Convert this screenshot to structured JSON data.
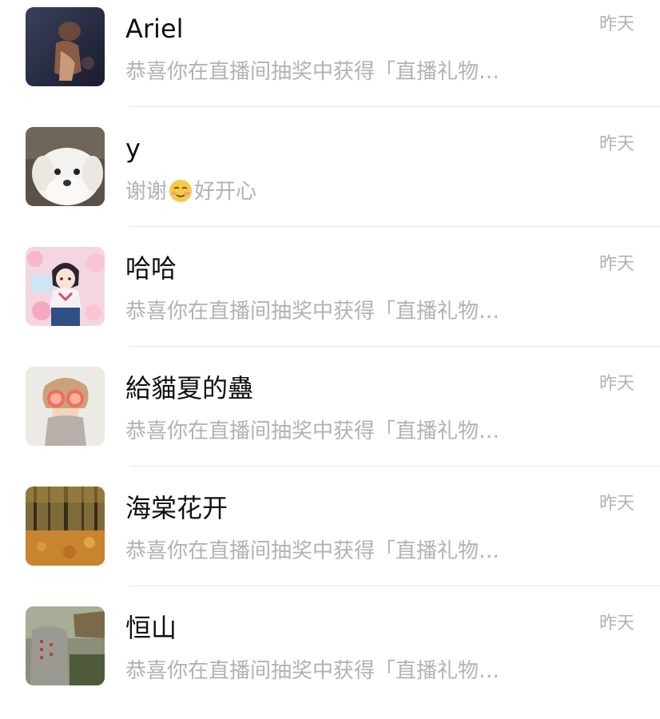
{
  "conversations": [
    {
      "name": "Ariel",
      "preview": "恭喜你在直播间抽奖中获得「直播礼物…",
      "time": "昨天",
      "avatar": "dark-photo-avatar"
    },
    {
      "name": "y",
      "preview_before": "谢谢",
      "preview_emoji": "smiling-face-emoji",
      "preview_after": "好开心",
      "time": "昨天",
      "avatar": "white-puppy-avatar"
    },
    {
      "name": "哈哈",
      "preview": "恭喜你在直播间抽奖中获得「直播礼物…",
      "time": "昨天",
      "avatar": "anime-girl-avatar"
    },
    {
      "name": "給貓夏的蠱",
      "preview": "恭喜你在直播间抽奖中获得「直播礼物…",
      "time": "昨天",
      "avatar": "girl-grapefruit-avatar"
    },
    {
      "name": "海棠花开",
      "preview": "恭喜你在直播间抽奖中获得「直播礼物…",
      "time": "昨天",
      "avatar": "autumn-forest-avatar"
    },
    {
      "name": "恒山",
      "preview": "恭喜你在直播间抽奖中获得「直播礼物…",
      "time": "昨天",
      "avatar": "stone-monument-avatar"
    }
  ],
  "colors": {
    "name_text": "#111111",
    "secondary_text": "#b2b2b2",
    "divider": "#e8e8e8",
    "background": "#ffffff"
  }
}
